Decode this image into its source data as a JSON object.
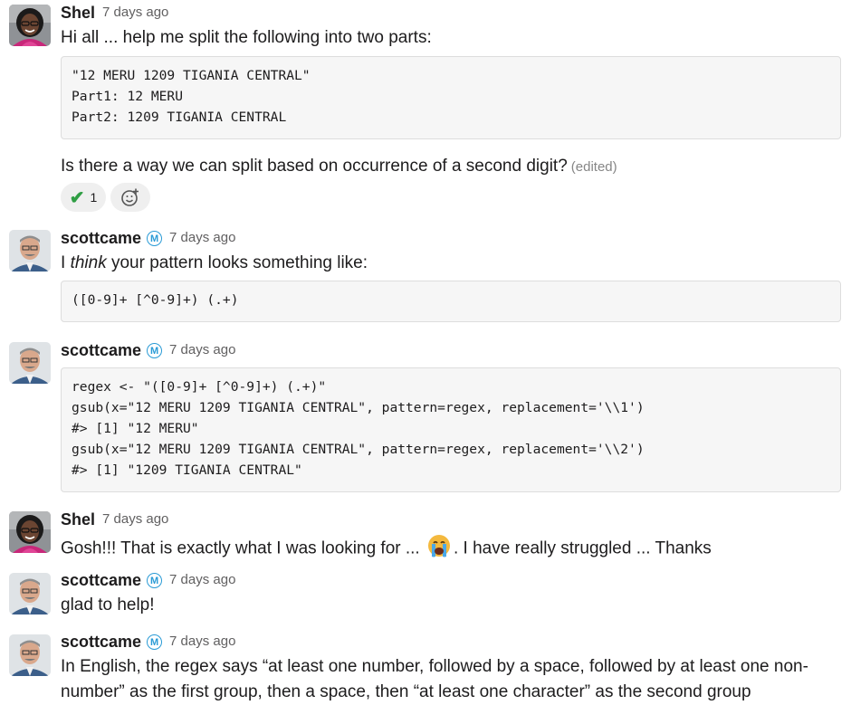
{
  "messages": [
    {
      "author": "Shel",
      "time": "7 days ago",
      "text": "Hi all ... help me split the following into two parts:",
      "code_lines": [
        "\"12 MERU 1209 TIGANIA CENTRAL\"",
        "Part1: 12 MERU",
        "Part2: 1209 TIGANIA CENTRAL"
      ],
      "text2": "Is there a way we can split based on occurrence of a second digit?",
      "edited": "(edited)",
      "reaction": {
        "emoji": "check-mark",
        "count": "1"
      }
    },
    {
      "author": "scottcame",
      "badge": "M",
      "time": "7 days ago",
      "text_before": "I ",
      "text_em": "think",
      "text_after": " your pattern looks something like:",
      "code_lines": [
        "([0-9]+ [^0-9]+) (.+)"
      ]
    },
    {
      "author": "scottcame",
      "badge": "M",
      "time": "7 days ago",
      "code_lines": [
        "regex <- \"([0-9]+ [^0-9]+) (.+)\"",
        "gsub(x=\"12 MERU 1209 TIGANIA CENTRAL\", pattern=regex, replacement='\\\\1')",
        "#> [1] \"12 MERU\"",
        "gsub(x=\"12 MERU 1209 TIGANIA CENTRAL\", pattern=regex, replacement='\\\\2')",
        "#> [1] \"1209 TIGANIA CENTRAL\""
      ]
    },
    {
      "author": "Shel",
      "time": "7 days ago",
      "text_before": "Gosh!!! That is exactly what I was looking for ... ",
      "emoji": "crying-face",
      "text_after": ". I have really struggled ... Thanks"
    },
    {
      "author": "scottcame",
      "badge": "M",
      "time": "7 days ago",
      "text": "glad to help!"
    },
    {
      "author": "scottcame",
      "badge": "M",
      "time": "7 days ago",
      "text_line1": "In English, the regex says “at least one number, followed by a space, followed by at least one non-",
      "text_line2": "number” as the first group, then a space, then “at least one character” as the second group"
    }
  ]
}
